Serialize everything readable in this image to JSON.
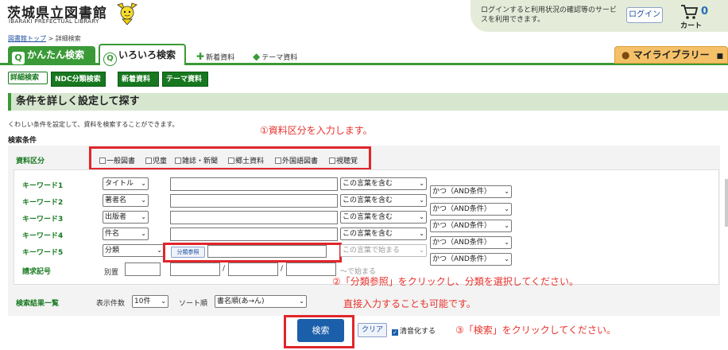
{
  "header": {
    "logo_ja": "茨城県立図書館",
    "logo_en": "IBARAKI PREFECTUAL LIBRARY",
    "login_message": "ログインすると利用状況の確認等のサービスを利用できます。",
    "login_button": "ログイン",
    "cart_count": "0",
    "cart_label": "カート"
  },
  "breadcrumb": {
    "home": "図書館トップ",
    "sep": " > ",
    "current": "詳細検索"
  },
  "tabs": {
    "simple": "かんたん検索",
    "advanced": "いろいろ検索",
    "new": "新着資料",
    "theme": "テーマ資料",
    "mylibrary": "マイライブラリー"
  },
  "subtabs": [
    "詳細検索",
    "NDC分類検索",
    "新着資料",
    "テーマ資料"
  ],
  "section": {
    "title": "条件を詳しく設定して探す",
    "description": "くわしい条件を設定して、資料を検索することができます。",
    "conditions_label": "検索条件"
  },
  "material": {
    "label": "資料区分",
    "options": [
      "一般図書",
      "児童",
      "雑誌・新聞",
      "郷土資料",
      "外国語図書",
      "視聴覚"
    ]
  },
  "keywords": [
    {
      "label": "キーワード1",
      "field": "タイトル",
      "match": "この言葉を含む",
      "op": "かつ（AND条件）"
    },
    {
      "label": "キーワード2",
      "field": "著者名",
      "match": "この言葉を含む",
      "op": "かつ（AND条件）"
    },
    {
      "label": "キーワード3",
      "field": "出版者",
      "match": "この言葉を含む",
      "op": "かつ（AND条件）"
    },
    {
      "label": "キーワード4",
      "field": "件名",
      "match": "この言葉を含む",
      "op": "かつ（AND条件）"
    },
    {
      "label": "キーワード5",
      "field": "分類",
      "match": "この言葉で始まる",
      "op": "かつ（AND条件）"
    }
  ],
  "bunrui_button": "分類参照",
  "callno": {
    "label": "請求記号",
    "sub": "別置",
    "sep1": "/",
    "sep2": "/",
    "hint": "～で始まる"
  },
  "results": {
    "label": "検索結果一覧",
    "count_label": "表示件数",
    "count": "10件",
    "sort_label": "ソート順",
    "sort": "書名順(あ→ん)"
  },
  "actions": {
    "search": "検索",
    "clear": "クリア",
    "seion": "清音化する"
  },
  "annotations": {
    "n1": "①資料区分を入力します。",
    "n2": "②「分類参照」をクリックし、分類を選択してください。",
    "n3": "直接入力することも可能です。",
    "n4": "③「検索」をクリックしてください。"
  },
  "colors": {
    "green": "#3a9a37",
    "dark_green": "#17781f",
    "red": "#e0262a",
    "blue": "#1b5faa",
    "orange": "#f5c168"
  }
}
